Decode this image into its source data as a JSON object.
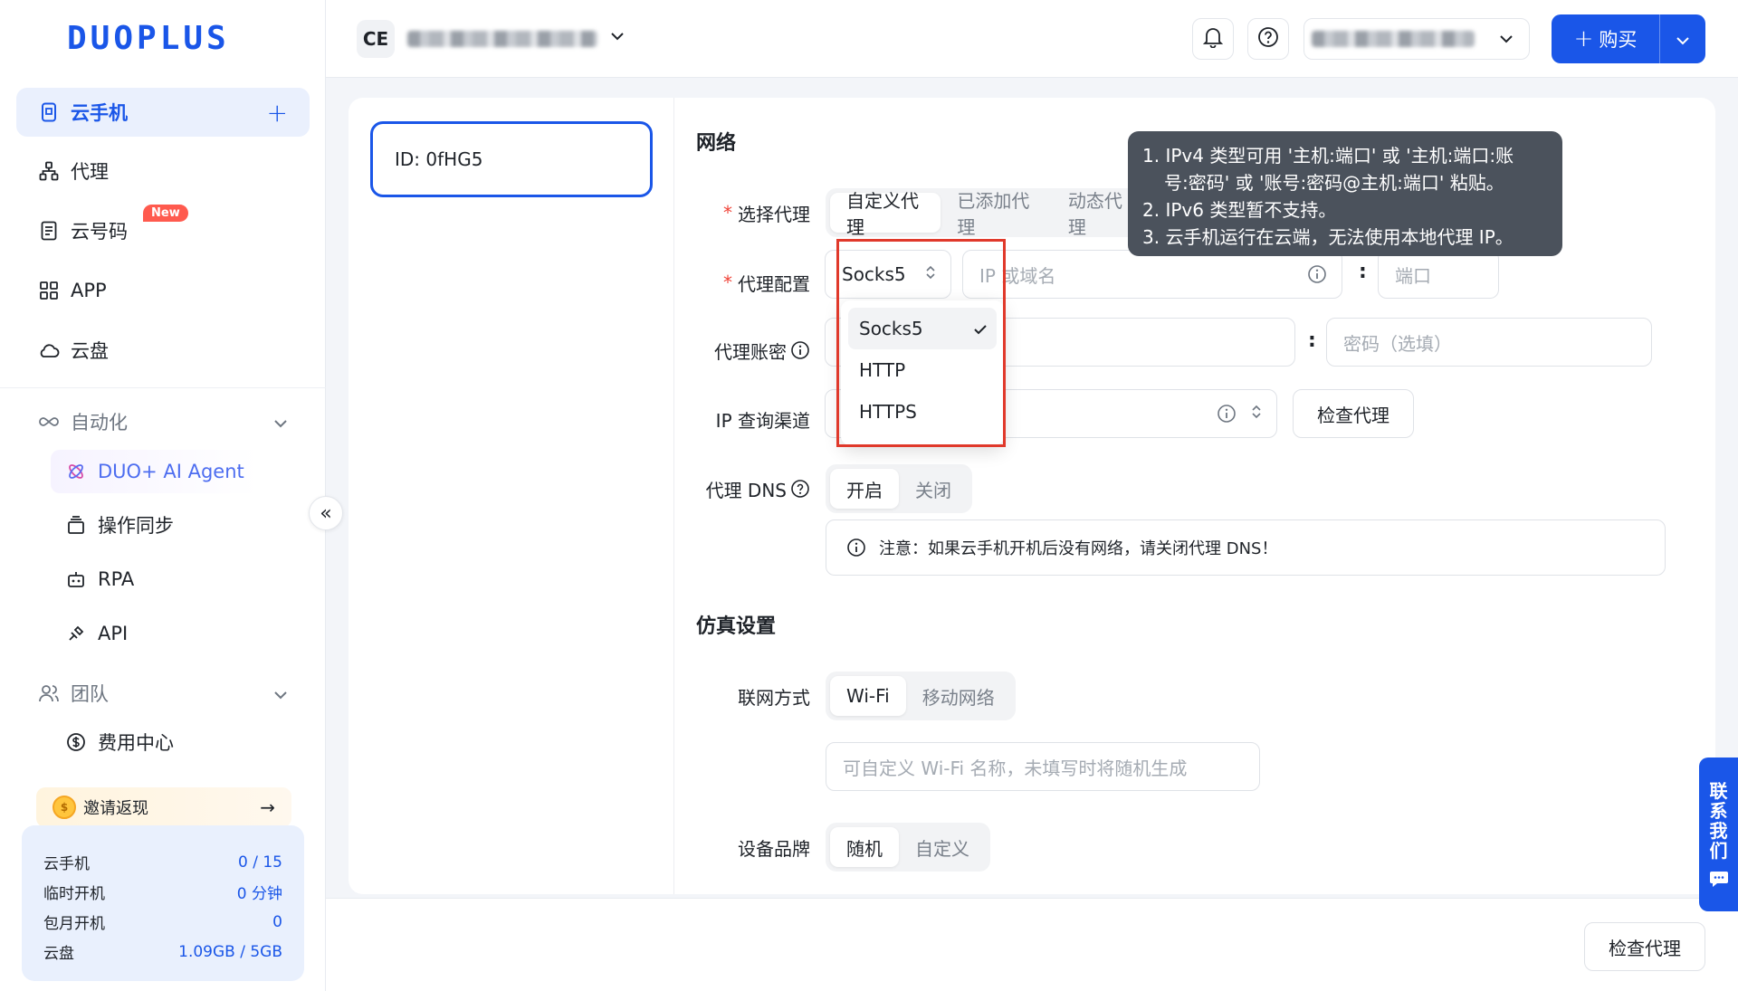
{
  "brand": {
    "logo_text": "DUOPLUS",
    "accent": "#1a56e8"
  },
  "sidebar": {
    "items": [
      {
        "label": "云手机",
        "icon": "phone-icon",
        "active": true
      },
      {
        "label": "代理",
        "icon": "proxy-icon"
      },
      {
        "label": "云号码",
        "icon": "sim-icon",
        "badge": "New"
      },
      {
        "label": "APP",
        "icon": "apps-grid-icon"
      },
      {
        "label": "云盘",
        "icon": "cloud-icon"
      }
    ],
    "automation": {
      "label": "自动化",
      "items": [
        {
          "label": "DUO+ AI Agent",
          "icon": "ai-agent-icon"
        },
        {
          "label": "操作同步",
          "icon": "sync-icon"
        },
        {
          "label": "RPA",
          "icon": "robot-icon"
        },
        {
          "label": "API",
          "icon": "api-plug-icon"
        }
      ]
    },
    "team": {
      "label": "团队",
      "items": [
        {
          "label": "费用中心",
          "icon": "dollar-icon"
        }
      ]
    },
    "invite": {
      "label": "邀请返现"
    },
    "quota": [
      {
        "label": "云手机",
        "value": "0 / 15"
      },
      {
        "label": "临时开机",
        "value": "0 分钟"
      },
      {
        "label": "包月开机",
        "value": "0"
      },
      {
        "label": "云盘",
        "value": "1.09GB / 5GB"
      }
    ]
  },
  "header": {
    "workspace_badge": "CE",
    "buy_label": "购买"
  },
  "device": {
    "label": "ID: 0fHG5"
  },
  "network": {
    "title": "网络",
    "select_proxy": {
      "label": "选择代理",
      "options": [
        "自定义代理",
        "已添加代理",
        "动态代理"
      ]
    },
    "proxy_config": {
      "label": "代理配置",
      "protocol": "Socks5",
      "host_placeholder": "IP 或域名",
      "port_placeholder": "端口"
    },
    "proxy_auth": {
      "label": "代理账密",
      "password_placeholder": "密码（选填）"
    },
    "ip_channel": {
      "label": "IP 查询渠道",
      "check_label": "检查代理"
    },
    "proxy_dns": {
      "label": "代理 DNS",
      "options": [
        "开启",
        "关闭"
      ]
    },
    "notice": "注意：如果云手机开机后没有网络，请关闭代理 DNS！"
  },
  "protocol_dropdown": {
    "options": [
      "Socks5",
      "HTTP",
      "HTTPS"
    ],
    "selected": "Socks5"
  },
  "tooltip": {
    "line1": "1. IPv4 类型可用 '主机:端口' 或 '主机:端口:账",
    "line1b": "号:密码' 或 '账号:密码@主机:端口' 粘贴。",
    "line2": "2. IPv6 类型暂不支持。",
    "line3": "3. 云手机运行在云端，无法使用本地代理 IP。"
  },
  "simulation": {
    "title": "仿真设置",
    "network_mode": {
      "label": "联网方式",
      "options": [
        "Wi-Fi",
        "移动网络"
      ]
    },
    "wifi_placeholder": "可自定义 Wi-Fi 名称，未填写时将随机生成",
    "brand": {
      "label": "设备品牌",
      "options": [
        "随机",
        "自定义"
      ]
    }
  },
  "footer": {
    "check_label": "检查代理"
  },
  "contact": {
    "chars": [
      "联",
      "系",
      "我",
      "们"
    ]
  }
}
